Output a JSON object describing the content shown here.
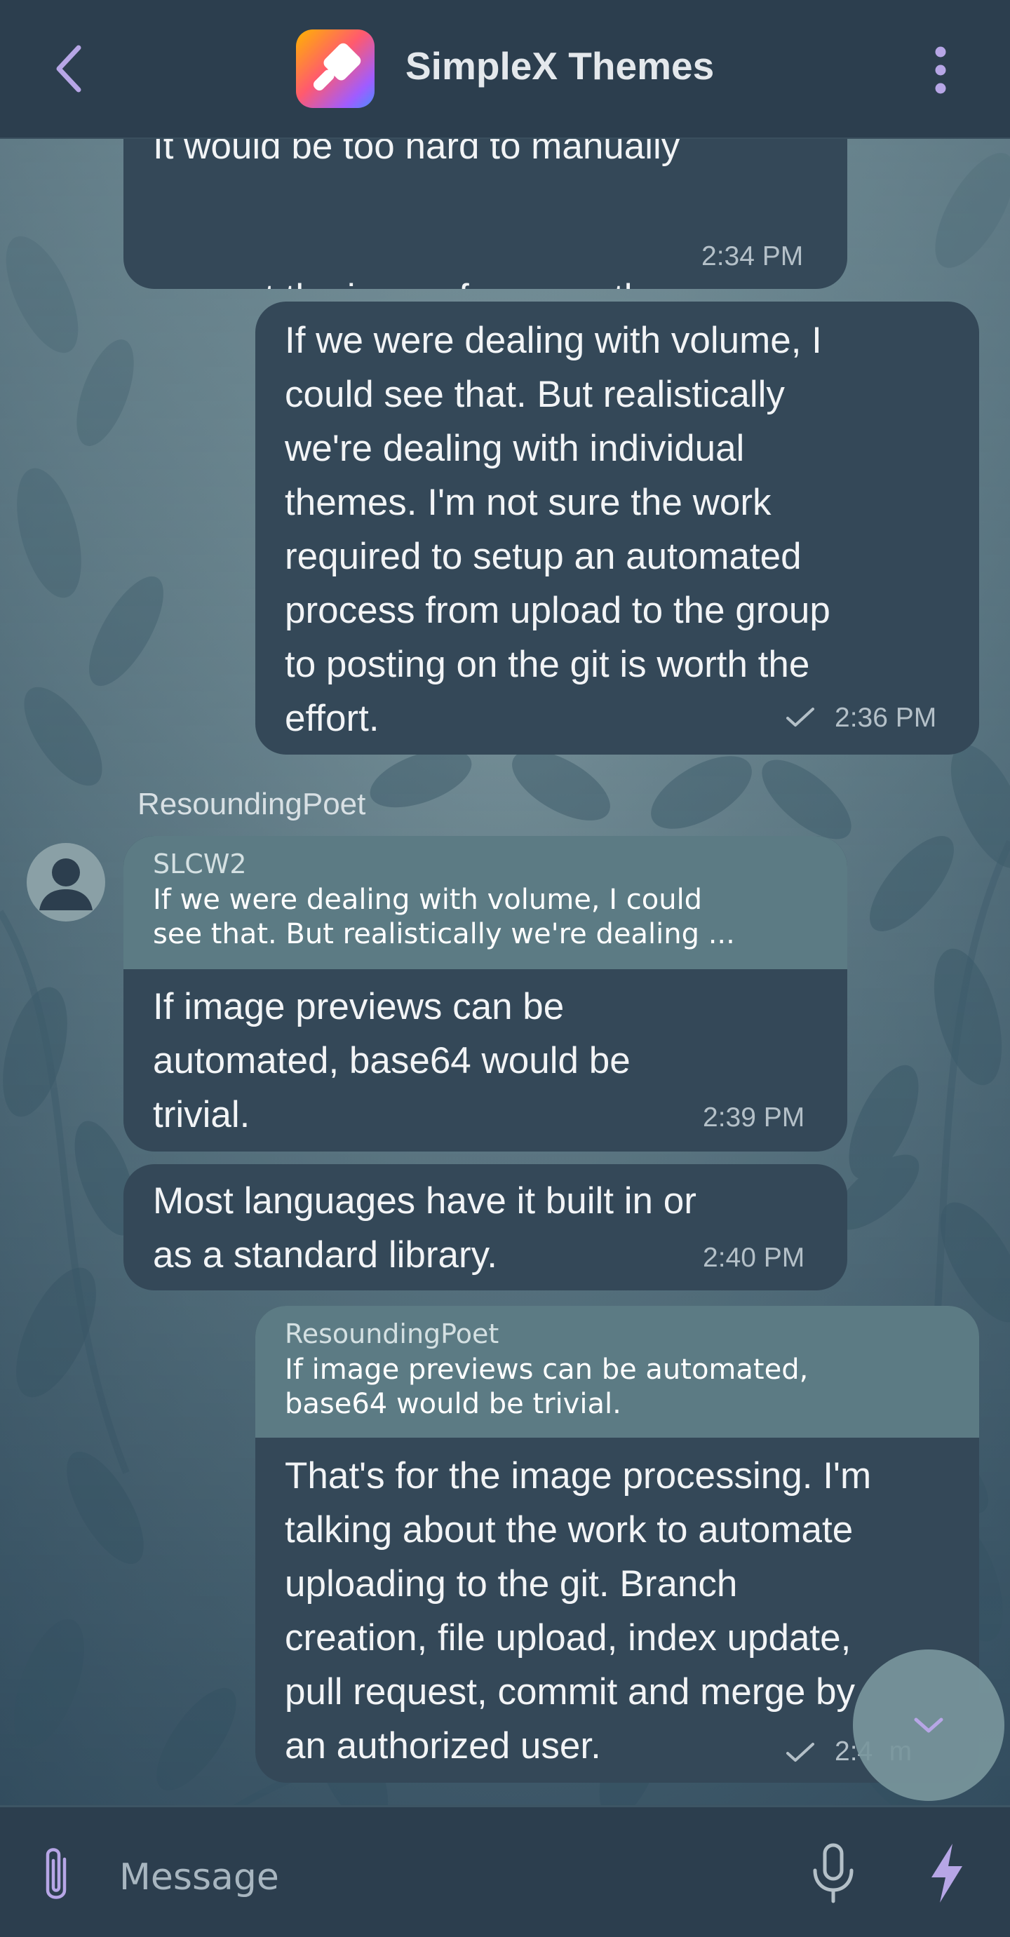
{
  "header": {
    "title": "SimpleX Themes"
  },
  "messages": [
    {
      "id": "m1",
      "direction": "incoming",
      "lines": [
        "It would be too hard to manually",
        "convert the image for every theme."
      ],
      "time": "2:34 PM"
    },
    {
      "id": "m2",
      "direction": "outgoing",
      "lines": [
        "If we were dealing with volume, I",
        "could see that. But realistically",
        "we're dealing with individual",
        "themes. I'm not sure the work",
        "required to setup an automated",
        "process from upload to the group",
        "to posting on the git is worth the",
        "effort."
      ],
      "time": "2:36 PM",
      "status": "sent"
    },
    {
      "id": "m3",
      "direction": "incoming",
      "sender": "ResoundingPoet",
      "quote": {
        "author": "SLCW2",
        "lines": [
          "If we were dealing with volume, I could",
          "see that. But realistically we're dealing ..."
        ]
      },
      "lines": [
        "If image previews can be",
        "automated, base64 would be",
        "trivial."
      ],
      "time": "2:39 PM"
    },
    {
      "id": "m4",
      "direction": "incoming",
      "lines": [
        "Most languages have it built in or",
        "as a standard library."
      ],
      "time": "2:40 PM"
    },
    {
      "id": "m5",
      "direction": "outgoing",
      "quote": {
        "author": "ResoundingPoet",
        "lines": [
          "If image previews can be automated,",
          "base64 would be trivial."
        ]
      },
      "lines": [
        "That's for the image processing. I'm",
        "talking about the work to automate",
        "uploading to the git. Branch",
        "creation, file upload, index update,",
        "pull request, commit and merge by",
        "an authorized user."
      ],
      "time": "2:4   m",
      "status": "sent"
    }
  ],
  "composer": {
    "placeholder": "Message"
  },
  "icons": {
    "back": "chevron-left-icon",
    "app": "paintbrush-app-icon",
    "menu": "vertical-dots-icon",
    "avatar": "user-silhouette-icon",
    "sent": "checkmark-icon",
    "scroll_down": "chevron-down-icon",
    "attach": "paperclip-icon",
    "mic": "microphone-icon",
    "bolt": "lightning-icon"
  },
  "colors": {
    "accent": "#b7a6e6",
    "header_bg": "#2c3e4e",
    "bubble_bg": "#344858",
    "quote_bg": "#5c7b84"
  }
}
